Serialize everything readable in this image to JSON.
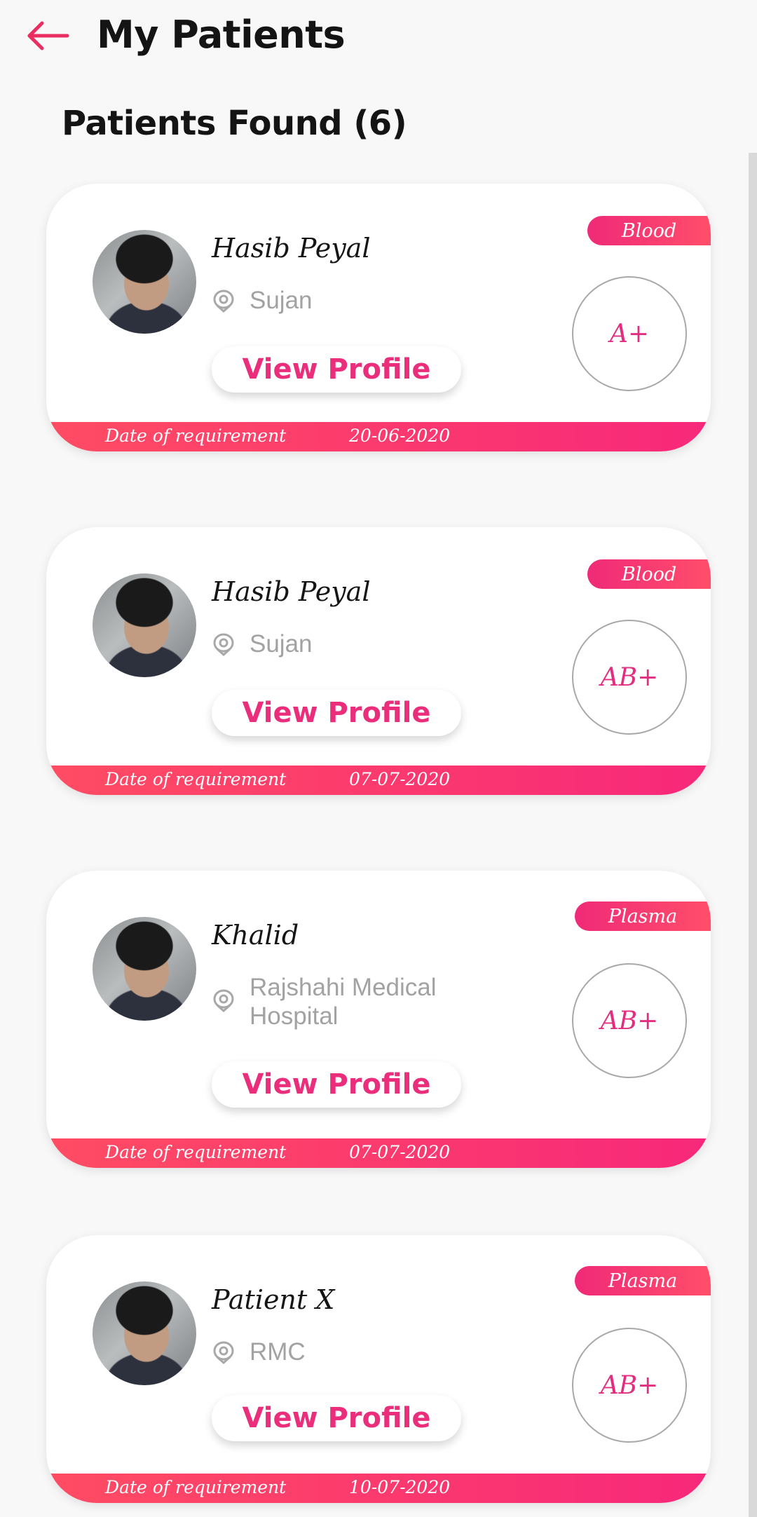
{
  "header": {
    "title": "My Patients",
    "back_icon": "arrow-left-icon",
    "accent_color": "#ea2e61"
  },
  "found_title": "Patients Found (6)",
  "patients": [
    {
      "name": "Hasib Peyal",
      "location": "Sujan",
      "button_label": "View Profile",
      "type": "Blood",
      "blood_group": "A+",
      "date_label": "Date of requirement",
      "date": "20-06-2020"
    },
    {
      "name": "Hasib Peyal",
      "location": "Sujan",
      "button_label": "View Profile",
      "type": "Blood",
      "blood_group": "AB+",
      "date_label": "Date of requirement",
      "date": "07-07-2020"
    },
    {
      "name": "Khalid",
      "location": "Rajshahi Medical Hospital",
      "button_label": "View Profile",
      "type": "Plasma",
      "blood_group": "AB+",
      "date_label": "Date of requirement",
      "date": "07-07-2020"
    },
    {
      "name": "Patient X",
      "location": "RMC",
      "button_label": "View Profile",
      "type": "Plasma",
      "blood_group": "AB+",
      "date_label": "Date of requirement",
      "date": "10-07-2020"
    }
  ],
  "colors": {
    "brand_pink": "#ea2e7c",
    "badge_gradient_start": "#f02a78",
    "badge_gradient_end": "#ff4e6a",
    "muted_text": "#a2a2a2"
  }
}
